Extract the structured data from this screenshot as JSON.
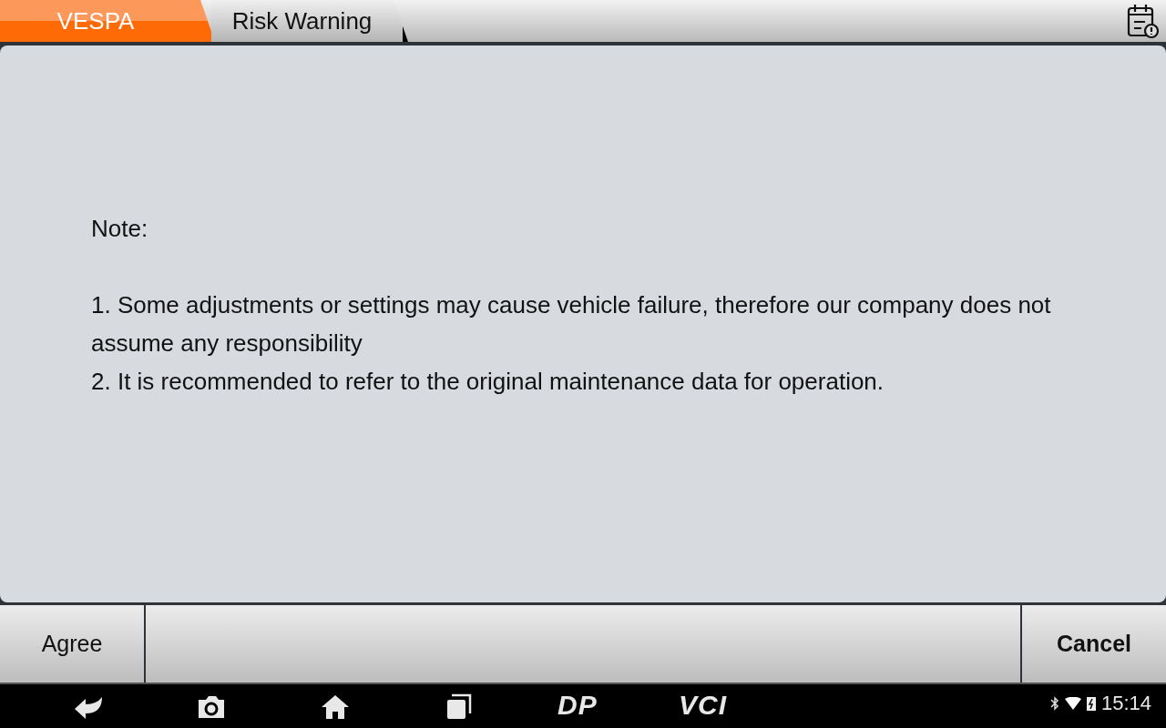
{
  "breadcrumbs": [
    {
      "label": "VESPA",
      "selected": true
    },
    {
      "label": "Risk Warning",
      "selected": false
    }
  ],
  "note": {
    "heading": "Note:",
    "lines": [
      "1. Some adjustments or settings may cause vehicle failure,  therefore our company does not assume any responsibility",
      "2. It is recommended to refer to the original maintenance data for operation."
    ]
  },
  "buttons": [
    {
      "label": "Agree",
      "kind": "normal"
    },
    {
      "label": "Cancel",
      "kind": "bold"
    }
  ],
  "nav_bar": {
    "logos": [
      "DP",
      "VCI"
    ],
    "time": "15:14"
  }
}
